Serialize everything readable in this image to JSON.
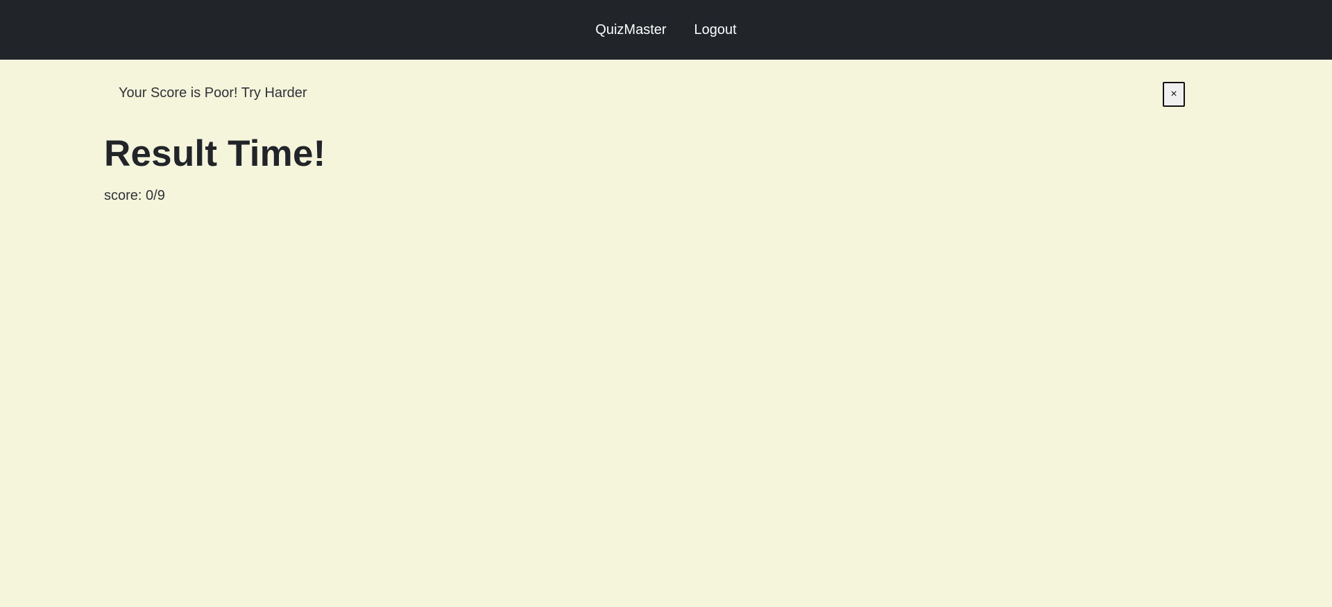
{
  "navbar": {
    "brand_label": "QuizMaster",
    "logout_label": "Logout"
  },
  "alert": {
    "message": "Your Score is Poor! Try Harder",
    "close_label": "×"
  },
  "main": {
    "title": "Result Time!",
    "score_text": "score: 0/9"
  },
  "colors": {
    "page_background": "#f5f5dc",
    "navbar_background": "#212529",
    "text": "#212529"
  }
}
